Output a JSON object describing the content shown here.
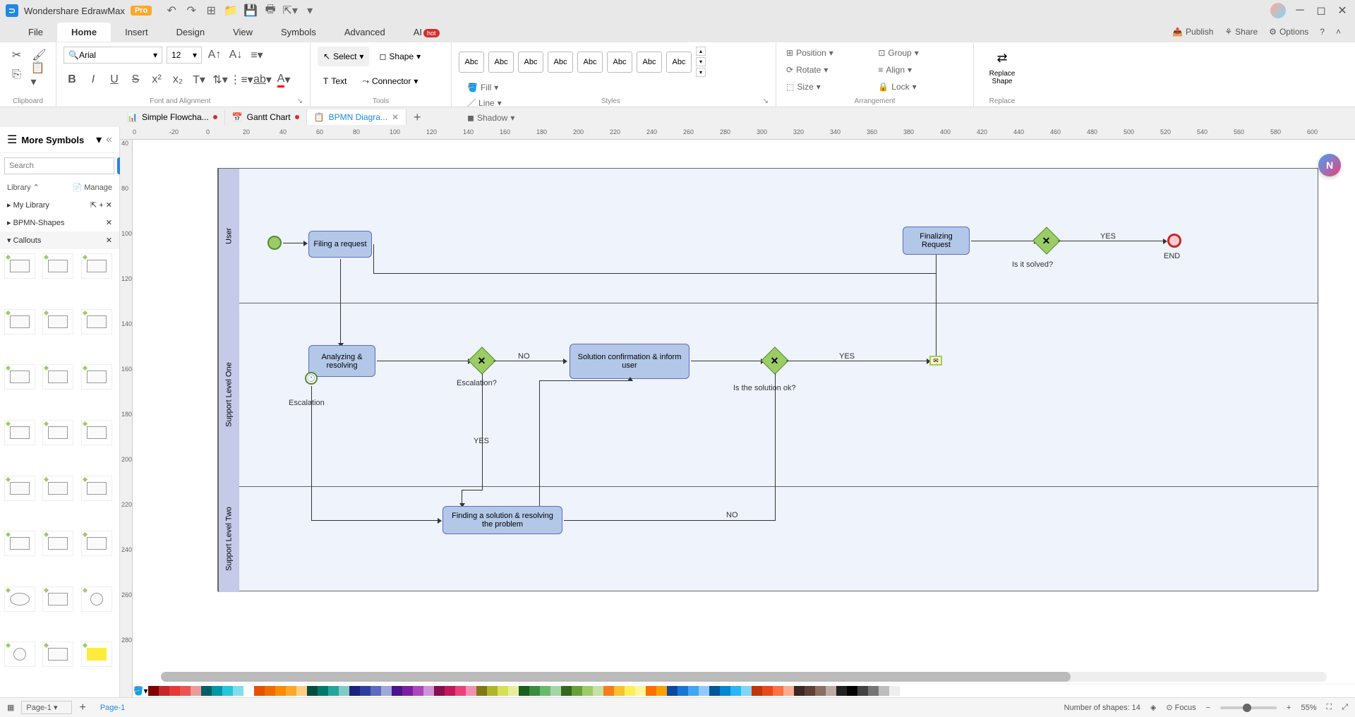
{
  "app": {
    "title": "Wondershare EdrawMax",
    "badge": "Pro"
  },
  "menu": {
    "file": "File",
    "home": "Home",
    "insert": "Insert",
    "design": "Design",
    "view": "View",
    "symbols": "Symbols",
    "advanced": "Advanced",
    "ai": "AI",
    "ai_badge": "hot"
  },
  "menubar_right": {
    "publish": "Publish",
    "share": "Share",
    "options": "Options"
  },
  "ribbon": {
    "clipboard_label": "Clipboard",
    "font_label": "Font and Alignment",
    "font_name": "Arial",
    "font_size": "12",
    "tools_label": "Tools",
    "select": "Select",
    "shape": "Shape",
    "text": "Text",
    "connector": "Connector",
    "styles_label": "Styles",
    "abc": "Abc",
    "fill": "Fill",
    "line": "Line",
    "shadow": "Shadow",
    "arrangement_label": "Arrangement",
    "position": "Position",
    "align": "Align",
    "group": "Group",
    "size": "Size",
    "rotate": "Rotate",
    "lock": "Lock",
    "replace_label": "Replace",
    "replace_shape": "Replace Shape"
  },
  "tabs": [
    {
      "label": "Simple Flowcha...",
      "modified": true
    },
    {
      "label": "Gantt Chart",
      "modified": true
    },
    {
      "label": "BPMN Diagra...",
      "active": true
    }
  ],
  "sidebar": {
    "title": "More Symbols",
    "search_placeholder": "Search",
    "search_btn": "Search",
    "library": "Library",
    "manage": "Manage",
    "my_library": "My Library",
    "bpmn_shapes": "BPMN-Shapes",
    "callouts": "Callouts"
  },
  "ruler_h": [
    "0",
    "-20",
    "0",
    "20",
    "40",
    "60",
    "80",
    "100",
    "120",
    "140",
    "160",
    "180",
    "200",
    "220",
    "240",
    "260",
    "280",
    "300",
    "320",
    "340",
    "360",
    "380",
    "400",
    "420",
    "440",
    "460",
    "480",
    "500",
    "520",
    "540",
    "560",
    "580",
    "600"
  ],
  "ruler_v": [
    "40",
    "",
    "80",
    "",
    "100",
    "",
    "120",
    "",
    "140",
    "",
    "160",
    "",
    "180",
    "",
    "200",
    "",
    "220",
    "",
    "240",
    "",
    "260",
    "",
    "280"
  ],
  "bpmn": {
    "lanes": [
      "User",
      "Support Level One",
      "Support Level Two"
    ],
    "tasks": {
      "filing": "Filing a request",
      "analyzing": "Analyzing & resolving",
      "solution_confirm": "Solution confirmation & inform user",
      "finalizing": "Finalizing Request",
      "finding": "Finding a solution & resolving the problem"
    },
    "labels": {
      "escalation": "Escalation",
      "escalation_q": "Escalation?",
      "solution_ok": "Is the solution ok?",
      "solved": "Is it solved?",
      "end": "END",
      "yes": "YES",
      "no": "NO"
    }
  },
  "status": {
    "page_select": "Page-1",
    "page_tab": "Page-1",
    "shapes": "Number of shapes: 14",
    "focus": "Focus",
    "zoom": "55%"
  },
  "colors": [
    "#7f0000",
    "#c62828",
    "#e53935",
    "#ef5350",
    "#ef9a9a",
    "#006064",
    "#0097a7",
    "#26c6da",
    "#80deea",
    "#ffffff",
    "#e65100",
    "#ef6c00",
    "#fb8c00",
    "#ffa726",
    "#ffcc80",
    "#004d40",
    "#00796b",
    "#26a69a",
    "#80cbc4",
    "#1a237e",
    "#303f9f",
    "#5c6bc0",
    "#9fa8da",
    "#4a148c",
    "#7b1fa2",
    "#ab47bc",
    "#ce93d8",
    "#880e4f",
    "#c2185b",
    "#ec407a",
    "#f48fb1",
    "#827717",
    "#afb42b",
    "#d4e157",
    "#e6ee9c",
    "#1b5e20",
    "#388e3c",
    "#66bb6a",
    "#a5d6a7",
    "#33691e",
    "#689f38",
    "#9ccc65",
    "#c5e1a5",
    "#f57f17",
    "#fbc02d",
    "#ffee58",
    "#fff59d",
    "#ff6f00",
    "#ffa000",
    "#0d47a1",
    "#1976d2",
    "#42a5f5",
    "#90caf9",
    "#01579b",
    "#0288d1",
    "#29b6f6",
    "#81d4fa",
    "#bf360c",
    "#e64a19",
    "#ff7043",
    "#ffab91",
    "#3e2723",
    "#5d4037",
    "#8d6e63",
    "#bcaaa4",
    "#212121",
    "#000000",
    "#424242",
    "#757575",
    "#bdbdbd",
    "#eeeeee",
    "#ffffff"
  ]
}
